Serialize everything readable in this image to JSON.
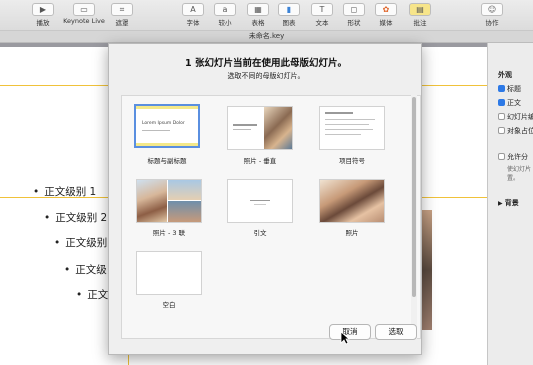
{
  "window": {
    "title": "未命名.key"
  },
  "toolbar": {
    "items": [
      {
        "label": "播放",
        "icon": "play-icon"
      },
      {
        "label": "Keynote Live",
        "icon": "keynote-live-icon"
      },
      {
        "label": "遮罩",
        "icon": "mask-icon"
      },
      {
        "label": "字体",
        "icon": "font-icon"
      },
      {
        "label": "较小",
        "icon": "smaller-icon"
      },
      {
        "label": "表格",
        "icon": "table-icon"
      },
      {
        "label": "图表",
        "icon": "chart-icon"
      },
      {
        "label": "文本",
        "icon": "text-icon"
      },
      {
        "label": "形状",
        "icon": "shape-icon"
      },
      {
        "label": "媒体",
        "icon": "media-icon"
      },
      {
        "label": "批注",
        "icon": "comment-icon"
      },
      {
        "label": "协作",
        "icon": "collaborate-icon"
      }
    ]
  },
  "slide": {
    "bullets": [
      "正文级别 1",
      "正文级别 2",
      "正文级别",
      "正文级",
      "正文"
    ]
  },
  "inspector": {
    "section_title": "外观",
    "checkboxes": [
      {
        "label": "标题",
        "checked": true
      },
      {
        "label": "正文",
        "checked": true
      },
      {
        "label": "幻灯片编",
        "checked": false
      },
      {
        "label": "对象占位",
        "checked": false
      }
    ],
    "allow_label": "允许分",
    "allow_sub": "使幻灯片",
    "allow_sub2": "置。",
    "background_label": "背景"
  },
  "dialog": {
    "title": "1 张幻灯片当前在使用此母版幻灯片。",
    "subtitle": "选取不同的母版幻灯片。",
    "thumb_text": "Lorem Ipsum Dolor",
    "masters": [
      {
        "label": "标题与副标题",
        "selected": true
      },
      {
        "label": "照片 - 垂直",
        "selected": false
      },
      {
        "label": "项目符号",
        "selected": false
      },
      {
        "label": "照片 - 3 联",
        "selected": false
      },
      {
        "label": "引文",
        "selected": false
      },
      {
        "label": "照片",
        "selected": false
      },
      {
        "label": "空白",
        "selected": false
      }
    ],
    "cancel_label": "取消",
    "choose_label": "选取"
  },
  "colors": {
    "accent": "#2d79e6",
    "guide": "#f0c23a",
    "selection": "#5a8fe0"
  }
}
